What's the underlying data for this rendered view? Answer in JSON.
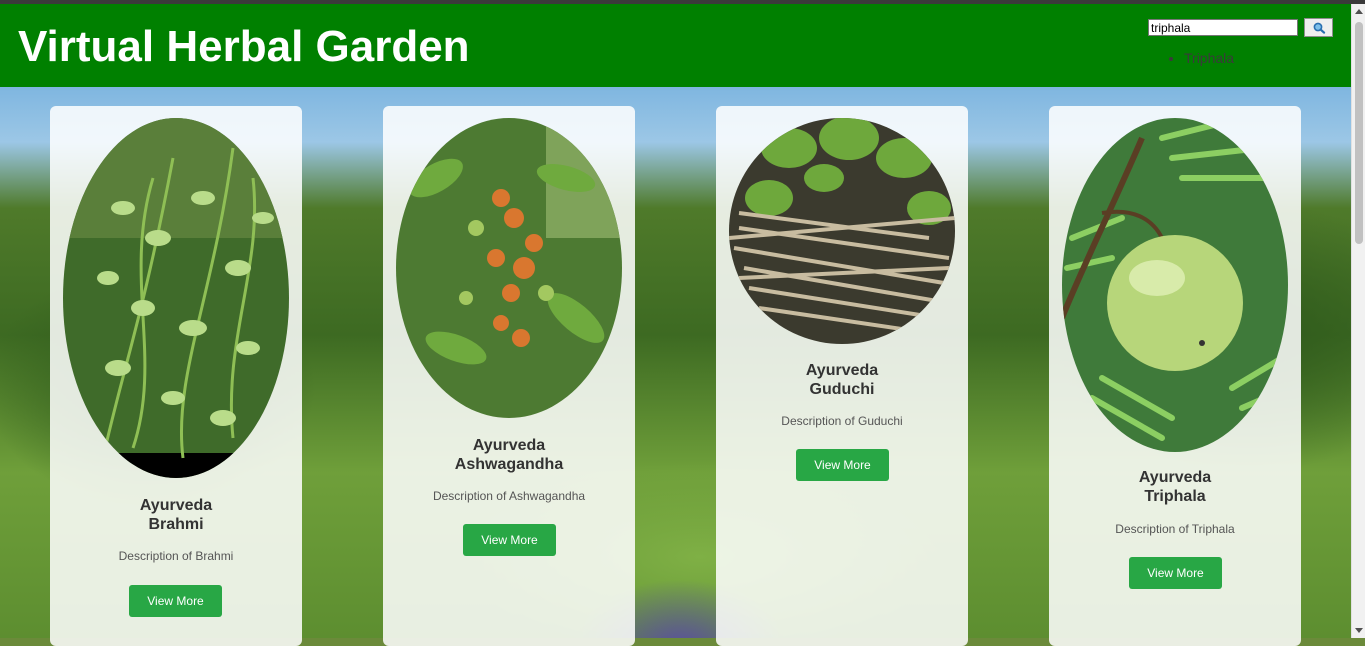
{
  "header": {
    "title": "Virtual Herbal Garden",
    "search": {
      "value": "triphala",
      "button_icon": "magnifier-icon"
    },
    "results": [
      "Triphala"
    ]
  },
  "cards": [
    {
      "title_line1": "Ayurveda",
      "title_line2": "Brahmi",
      "description": "Description of Brahmi",
      "button_label": "View More",
      "image": "brahmi-plant-image"
    },
    {
      "title_line1": "Ayurveda",
      "title_line2": "Ashwagandha",
      "description": "Description of Ashwagandha",
      "button_label": "View More",
      "image": "ashwagandha-plant-image"
    },
    {
      "title_line1": "Ayurveda",
      "title_line2": "Guduchi",
      "description": "Description of Guduchi",
      "button_label": "View More",
      "image": "guduchi-plant-image"
    },
    {
      "title_line1": "Ayurveda",
      "title_line2": "Triphala",
      "description": "Description of Triphala",
      "button_label": "View More",
      "image": "amla-fruit-image"
    }
  ],
  "colors": {
    "header": "#008000",
    "button": "#28a745",
    "title_text": "#ffffff"
  }
}
